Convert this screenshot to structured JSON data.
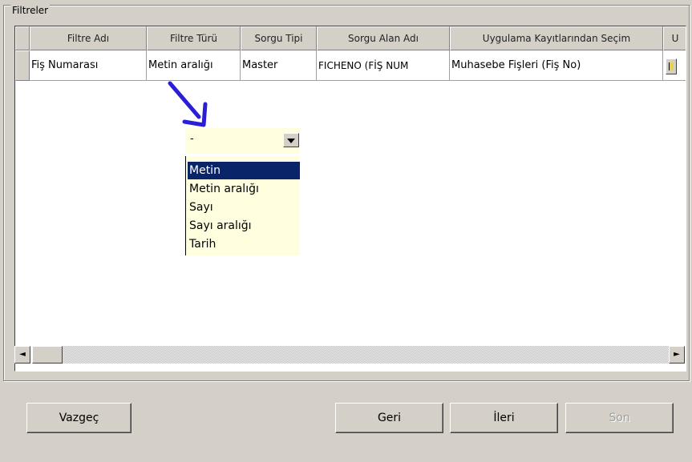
{
  "group": {
    "title": "Filtreler"
  },
  "table": {
    "columns": [
      "Filtre Adı",
      "Filtre Türü",
      "Sorgu Tipi",
      "Sorgu Alan Adı",
      "Uygulama Kayıtlarından Seçim",
      "U"
    ],
    "rows": [
      [
        "Fiş Numarası",
        "Metin aralığı",
        "Master",
        "FICHENO (FİŞ NUM",
        "Muhasebe Fişleri (Fiş No)"
      ]
    ]
  },
  "dropdown": {
    "current": "-",
    "options": [
      "Metin",
      "Metin aralığı",
      "Sayı",
      "Sayı aralığı",
      "Tarih"
    ],
    "selected_index": 0
  },
  "buttons": {
    "cancel": "Vazgeç",
    "back": "Geri",
    "next": "İleri",
    "finish": "Son"
  },
  "colors": {
    "window_bg": "#d4d0c8",
    "selection": "#0a246a",
    "dropdown_bg": "#ffffe0",
    "arrow": "#2a1fd6"
  },
  "icons": {
    "scroll_left": "◄",
    "scroll_right": "►"
  }
}
